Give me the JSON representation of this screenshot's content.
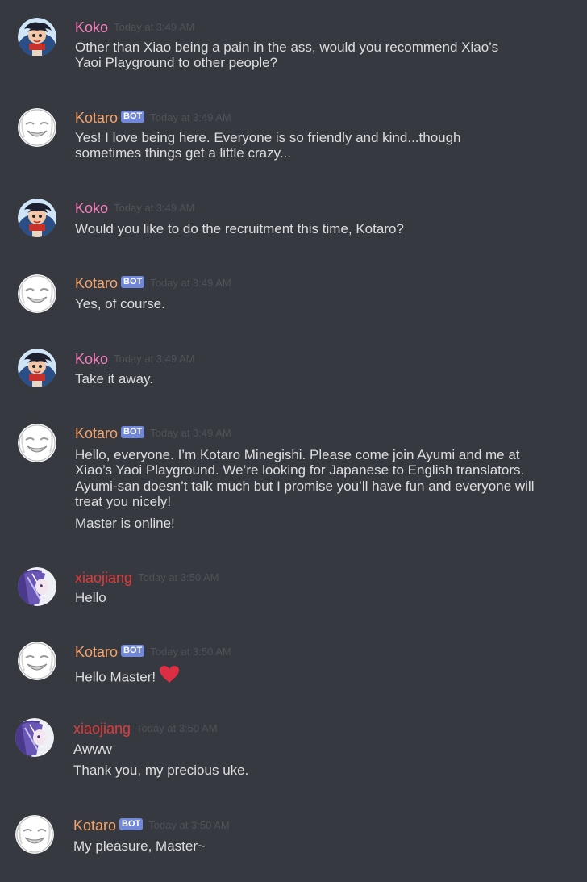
{
  "colors": {
    "background": "#36393f",
    "koko": "#f47fbc",
    "kotaro": "#f5a36a",
    "xiaojiang": "#e03c3c",
    "bot_badge": "#7289da",
    "timestamp": "#4f5257",
    "text": "#dcddde"
  },
  "bot_label": "BOT",
  "messages": [
    {
      "author": "Koko",
      "time": "Today at 3:49 AM",
      "lines": [
        "Other than Xiao being a pain in the ass, would you recommend Xiao’s",
        "Yaoi Playground to other people?"
      ]
    },
    {
      "author": "Kotaro",
      "time": "Today at 3:49 AM",
      "lines": [
        "Yes! I love being here. Everyone is so friendly and kind...though",
        "sometimes things get a little crazy..."
      ]
    },
    {
      "author": "Koko",
      "time": "Today at 3:49 AM",
      "lines": [
        "Would you like to do the recruitment this time, Kotaro?"
      ]
    },
    {
      "author": "Kotaro",
      "time": "Today at 3:49 AM",
      "lines": [
        "Yes, of course."
      ]
    },
    {
      "author": "Koko",
      "time": "Today at 3:49 AM",
      "lines": [
        "Take it away."
      ]
    },
    {
      "author": "Kotaro",
      "time": "Today at 3:49 AM",
      "lines": [
        "Hello, everyone. I’m Kotaro Minegishi. Please come join Ayumi and me at",
        "Xiao’s Yaoi Playground. We’re looking for Japanese to English translators.",
        "Ayumi-san doesn’t talk much but I promise you’ll have fun and everyone will",
        "treat you nicely!",
        "Master is online!"
      ]
    },
    {
      "author": "xiaojiang",
      "time": "Today at 3:50 AM",
      "lines": [
        "Hello"
      ]
    },
    {
      "author": "Kotaro",
      "time": "Today at 3:50 AM",
      "lines": [
        "Hello Master!"
      ],
      "emoji": "heart-icon"
    },
    {
      "author": "xiaojiang",
      "time": "Today at 3:50 AM",
      "lines": [
        "Awww",
        "Thank you, my precious uke."
      ]
    },
    {
      "author": "Kotaro",
      "time": "Today at 3:50 AM",
      "lines": [
        "My pleasure, Master~"
      ]
    }
  ]
}
